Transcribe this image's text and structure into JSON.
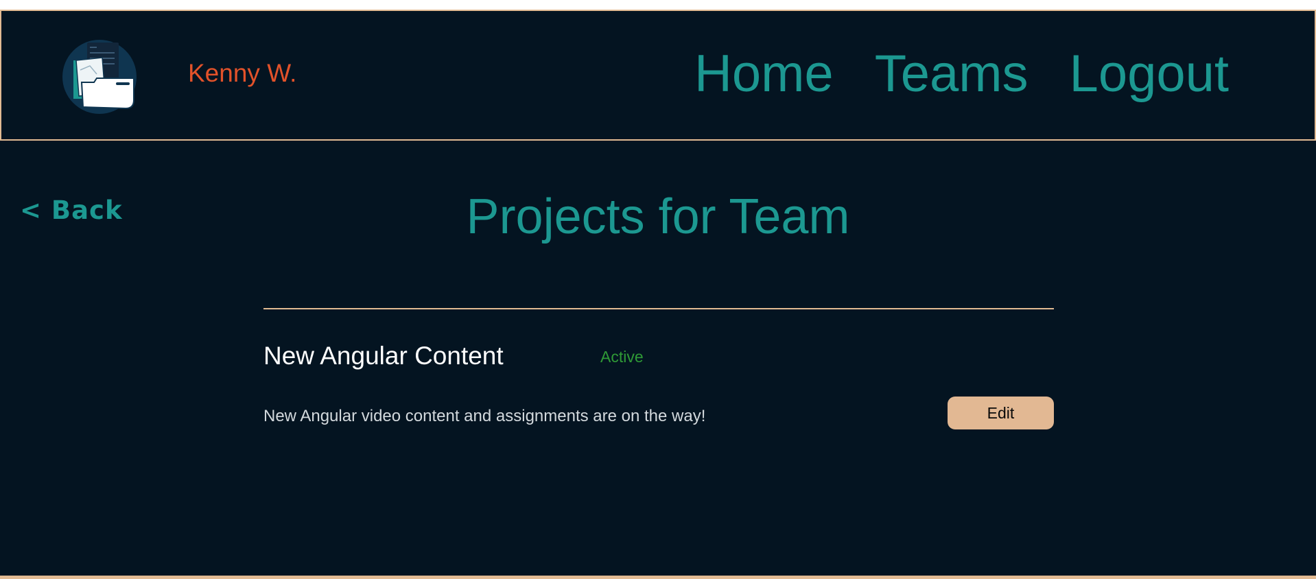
{
  "header": {
    "username": "Kenny W.",
    "nav": {
      "home": "Home",
      "teams": "Teams",
      "logout": "Logout"
    },
    "logo_icon": "folder-document-icon"
  },
  "main": {
    "back_label": "< Back",
    "title": "Projects for Team",
    "projects": [
      {
        "name": "New Angular Content",
        "status": "Active",
        "description": "New Angular video content and assignments are on the way!",
        "edit_label": "Edit"
      }
    ]
  },
  "colors": {
    "background": "#041421",
    "accent_teal": "#1c9891",
    "username_orange": "#e2522a",
    "border_tan": "#e2bb93",
    "status_green": "#2f9a36",
    "button_tan": "#e2b893"
  }
}
